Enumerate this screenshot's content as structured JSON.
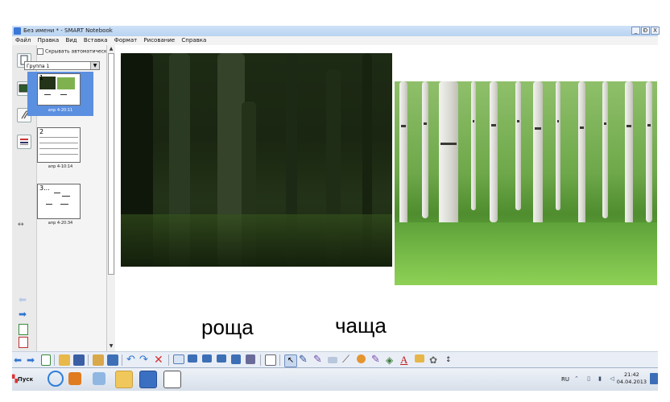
{
  "window": {
    "title": "Без имени * - SMART Notebook",
    "buttons": {
      "minimize": "_",
      "restore": "Ɖ",
      "close": "X"
    }
  },
  "menu": [
    "Файл",
    "Правка",
    "Вид",
    "Вставка",
    "Формат",
    "Рисование",
    "Справка"
  ],
  "sorter": {
    "autohide_label": "Скрывать автоматически",
    "group_select": "Группа 1",
    "pages": [
      {
        "number": "1",
        "label": "апр 4-20:11",
        "selected": true
      },
      {
        "number": "2",
        "label": "апр 4-10:14",
        "selected": false
      },
      {
        "number": "3...",
        "label": "апр 4-20:34",
        "selected": false
      }
    ]
  },
  "side_icons": [
    "page-sorter-icon",
    "gallery-icon",
    "attachments-icon",
    "properties-icon"
  ],
  "canvas": {
    "word_left": "роща",
    "word_right": "чаща"
  },
  "toolbar": {
    "icons": [
      "back-icon",
      "forward-icon",
      "add-page-icon",
      "open-icon",
      "save-icon",
      "paste-icon",
      "delete-page-icon",
      "undo-icon",
      "redo-icon",
      "delete-icon",
      "screen-shade-icon",
      "fullscreen-icon",
      "dual-page-icon",
      "display-icon",
      "capture-icon",
      "table-icon",
      "select-icon",
      "pen-icon",
      "creative-pen-icon",
      "eraser-icon",
      "line-icon",
      "shape-icon",
      "magic-pen-icon",
      "fill-icon",
      "text-icon",
      "properties-icon",
      "recognize-icon",
      "more-icon"
    ]
  },
  "taskbar": {
    "start_label": "Пуск",
    "apps": [
      "ie-icon",
      "media-icon",
      "paint-icon",
      "folder-icon",
      "smart-notebook-icon",
      "document-icon"
    ],
    "tray": {
      "language": "RU",
      "time": "21:42",
      "date": "04.04.2013"
    }
  },
  "colors": {
    "titlebar": "#c4daf4",
    "selection": "#5b8fe0",
    "canvas": "#ffffff"
  }
}
